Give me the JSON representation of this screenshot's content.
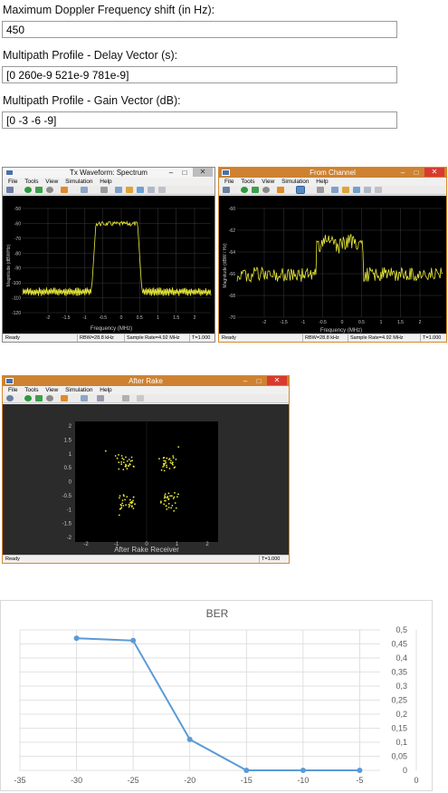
{
  "form": {
    "doppler_label": "Maximum Doppler Frequency shift (in Hz):",
    "doppler_value": "450",
    "delay_label": "Multipath Profile - Delay Vector (s):",
    "delay_value": "[0 260e-9 521e-9 781e-9]",
    "gain_label": "Multipath Profile - Gain Vector (dB):",
    "gain_value": "[0 -3 -6 -9]"
  },
  "menu": {
    "file": "File",
    "tools": "Tools",
    "view": "View",
    "simulation": "Simulation",
    "help": "Help"
  },
  "window_controls": {
    "minimize": "–",
    "maximize": "□",
    "close": "✕"
  },
  "tx_scope": {
    "title": "Tx Waveform: Spectrum",
    "ylabel": "Magnitude (dBW/Hz)",
    "xlabel": "Frequency (MHz)",
    "yticks": [
      "-50",
      "-60",
      "-70",
      "-80",
      "-90",
      "-100",
      "-110",
      "-120"
    ],
    "xticks": [
      "-2",
      "-1.5",
      "-1",
      "-0.5",
      "0",
      "0.5",
      "1",
      "1.5",
      "2"
    ],
    "status": "Ready",
    "rbw": "RBW=28.8 kHz",
    "sample_rate": "Sample Rate=4.92 MHz",
    "time": "T=1.000"
  },
  "rx_scope": {
    "title": "From Channel",
    "ylabel": "Magnitude (dBW / Hz)",
    "xlabel": "Frequency (MHz)",
    "yticks": [
      "-60",
      "-62",
      "-64",
      "-66",
      "-68",
      "-70"
    ],
    "xticks": [
      "-2",
      "-1.5",
      "-1",
      "-0.5",
      "0",
      "0.5",
      "1",
      "1.5",
      "2"
    ],
    "status": "Ready",
    "rbw": "RBW=28.8 kHz",
    "sample_rate": "Sample Rate=4.92 MHz",
    "time": "T=1.000"
  },
  "rake_scope": {
    "title": "After Rake",
    "xlabel": "After Rake Receiver",
    "yticks": [
      "2",
      "1.5",
      "1",
      "0.5",
      "0",
      "-0.5",
      "-1",
      "-1.5",
      "-2"
    ],
    "xticks": [
      "-2",
      "-1",
      "0",
      "1",
      "2"
    ],
    "status": "Ready",
    "time": "T=1.000"
  },
  "chart_data": {
    "type": "line",
    "title": "BER",
    "x": [
      -30,
      -25,
      -20,
      -15,
      -10,
      -5
    ],
    "y": [
      0.47,
      0.462,
      0.11,
      0.0,
      0.0,
      0.0
    ],
    "xlim": [
      -35,
      0
    ],
    "ylim": [
      0,
      0.5
    ],
    "xticks": [
      "-35",
      "-30",
      "-25",
      "-20",
      "-15",
      "-10",
      "-5",
      "0"
    ],
    "yticks": [
      "0",
      "0,05",
      "0,1",
      "0,15",
      "0,2",
      "0,25",
      "0,3",
      "0,35",
      "0,4",
      "0,45",
      "0,5"
    ],
    "grid": true,
    "line_color": "#5b9bd5",
    "y_axis_position": "right"
  },
  "colors": {
    "trace": "#e8e83a",
    "orange_titlebar": "#ce8231",
    "close_red": "#d83a2e"
  }
}
